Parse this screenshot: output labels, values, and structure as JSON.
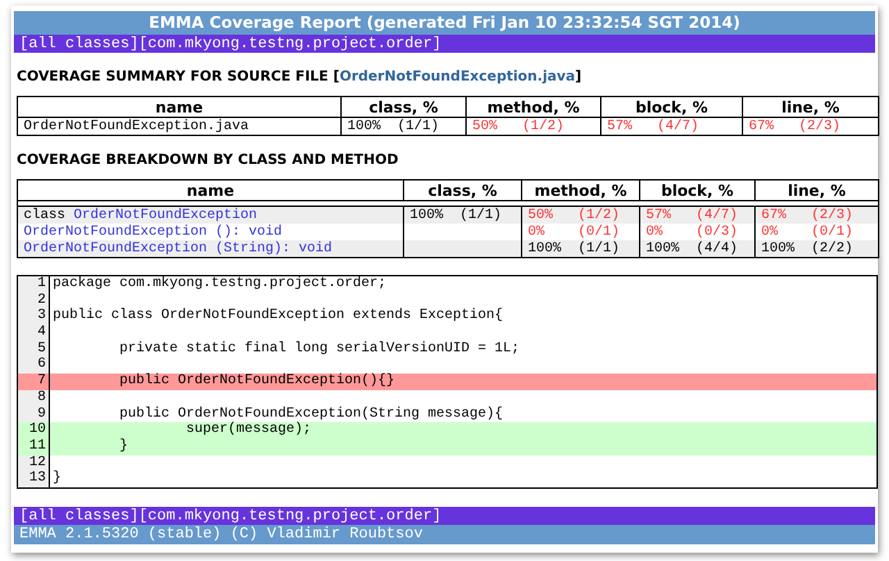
{
  "title": "EMMA Coverage Report (generated Fri Jan 10 23:32:54 SGT 2014)",
  "nav_top": [
    "[all classes]",
    "[com.mkyong.testng.project.order]"
  ],
  "summary": {
    "heading_prefix": "COVERAGE SUMMARY FOR SOURCE FILE [",
    "heading_link": "OrderNotFoundException.java",
    "heading_suffix": "]",
    "columns": [
      "name",
      "class, %",
      "method, %",
      "block, %",
      "line, %"
    ],
    "rows": [
      {
        "cells": [
          {
            "kind": "file",
            "name": "OrderNotFoundException.java"
          },
          {
            "kind": "coverage",
            "pct": "100%",
            "ratio": "(1/1)",
            "low": false
          },
          {
            "kind": "coverage",
            "pct": "50%",
            "ratio": "(1/2)",
            "low": true
          },
          {
            "kind": "coverage",
            "pct": "57%",
            "ratio": "(4/7)",
            "low": true
          },
          {
            "kind": "coverage",
            "pct": "67%",
            "ratio": "(2/3)",
            "low": true
          }
        ]
      }
    ]
  },
  "breakdown": {
    "heading": "COVERAGE BREAKDOWN BY CLASS AND METHOD",
    "columns": [
      "name",
      "class, %",
      "method, %",
      "block, %",
      "line, %"
    ],
    "rows": [
      {
        "cells": [
          {
            "kind": "class",
            "prefix": "class ",
            "name": "OrderNotFoundException"
          },
          {
            "kind": "coverage",
            "pct": "100%",
            "ratio": "(1/1)",
            "low": false
          },
          {
            "kind": "coverage",
            "pct": "50%",
            "ratio": "(1/2)",
            "low": true
          },
          {
            "kind": "coverage",
            "pct": "57%",
            "ratio": "(4/7)",
            "low": true
          },
          {
            "kind": "coverage",
            "pct": "67%",
            "ratio": "(2/3)",
            "low": true
          }
        ]
      },
      {
        "cells": [
          {
            "kind": "method",
            "name": "OrderNotFoundException (): void"
          },
          "",
          {
            "kind": "coverage",
            "pct": "0%",
            "ratio": "(0/1)",
            "low": true
          },
          {
            "kind": "coverage",
            "pct": "0%",
            "ratio": "(0/3)",
            "low": true
          },
          {
            "kind": "coverage",
            "pct": "0%",
            "ratio": "(0/1)",
            "low": true
          }
        ]
      },
      {
        "cells": [
          {
            "kind": "method",
            "name": "OrderNotFoundException (String): void"
          },
          "",
          {
            "kind": "coverage",
            "pct": "100%",
            "ratio": "(1/1)",
            "low": false
          },
          {
            "kind": "coverage",
            "pct": "100%",
            "ratio": "(4/4)",
            "low": false
          },
          {
            "kind": "coverage",
            "pct": "100%",
            "ratio": "(2/2)",
            "low": false
          }
        ]
      }
    ]
  },
  "source": [
    {
      "number": "1",
      "code": "package com.mkyong.testng.project.order;",
      "missed": false,
      "covered": false
    },
    {
      "number": "2",
      "missed": false,
      "covered": false
    },
    {
      "number": "3",
      "code": "public class OrderNotFoundException extends Exception{",
      "missed": false,
      "covered": false
    },
    {
      "number": "4",
      "missed": false,
      "covered": false
    },
    {
      "number": "5",
      "code": "        private static final long serialVersionUID = 1L;",
      "missed": false,
      "covered": false
    },
    {
      "number": "6",
      "missed": false,
      "covered": false
    },
    {
      "number": "7",
      "code": "        public OrderNotFoundException(){}",
      "missed": true,
      "covered": false
    },
    {
      "number": "8",
      "missed": false,
      "covered": false
    },
    {
      "number": "9",
      "code": "        public OrderNotFoundException(String message){",
      "missed": false,
      "covered": false
    },
    {
      "number": "10",
      "code": "                super(message);",
      "missed": false,
      "covered": true
    },
    {
      "number": "11",
      "code": "        }",
      "missed": false,
      "covered": true
    },
    {
      "number": "12",
      "missed": false,
      "covered": false
    },
    {
      "number": "13",
      "code": "}",
      "missed": false,
      "covered": false
    }
  ],
  "nav_bottom": [
    "[all classes]",
    "[com.mkyong.testng.project.order]"
  ],
  "footer": "EMMA 2.1.5320 (stable) (C) Vladimir Roubtsov"
}
